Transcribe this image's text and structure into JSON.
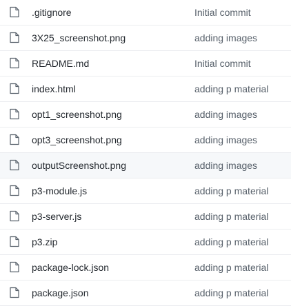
{
  "files": [
    {
      "name": ".gitignore",
      "commit": "Initial commit",
      "icon": "file-icon"
    },
    {
      "name": "3X25_screenshot.png",
      "commit": "adding images",
      "icon": "file-icon"
    },
    {
      "name": "README.md",
      "commit": "Initial commit",
      "icon": "file-icon"
    },
    {
      "name": "index.html",
      "commit": "adding p material",
      "icon": "file-icon"
    },
    {
      "name": "opt1_screenshot.png",
      "commit": "adding images",
      "icon": "file-icon"
    },
    {
      "name": "opt3_screenshot.png",
      "commit": "adding images",
      "icon": "file-icon"
    },
    {
      "name": "outputScreenshot.png",
      "commit": "adding images",
      "icon": "file-icon"
    },
    {
      "name": "p3-module.js",
      "commit": "adding p material",
      "icon": "file-icon"
    },
    {
      "name": "p3-server.js",
      "commit": "adding p material",
      "icon": "file-icon"
    },
    {
      "name": "p3.zip",
      "commit": "adding p material",
      "icon": "file-icon"
    },
    {
      "name": "package-lock.json",
      "commit": "adding p material",
      "icon": "file-icon"
    },
    {
      "name": "package.json",
      "commit": "adding p material",
      "icon": "file-icon"
    }
  ],
  "colors": {
    "text": "#24292f",
    "muted": "#57606a",
    "border": "#eaecef",
    "highlight": "#f6f8fa",
    "icon": "#57606a"
  }
}
